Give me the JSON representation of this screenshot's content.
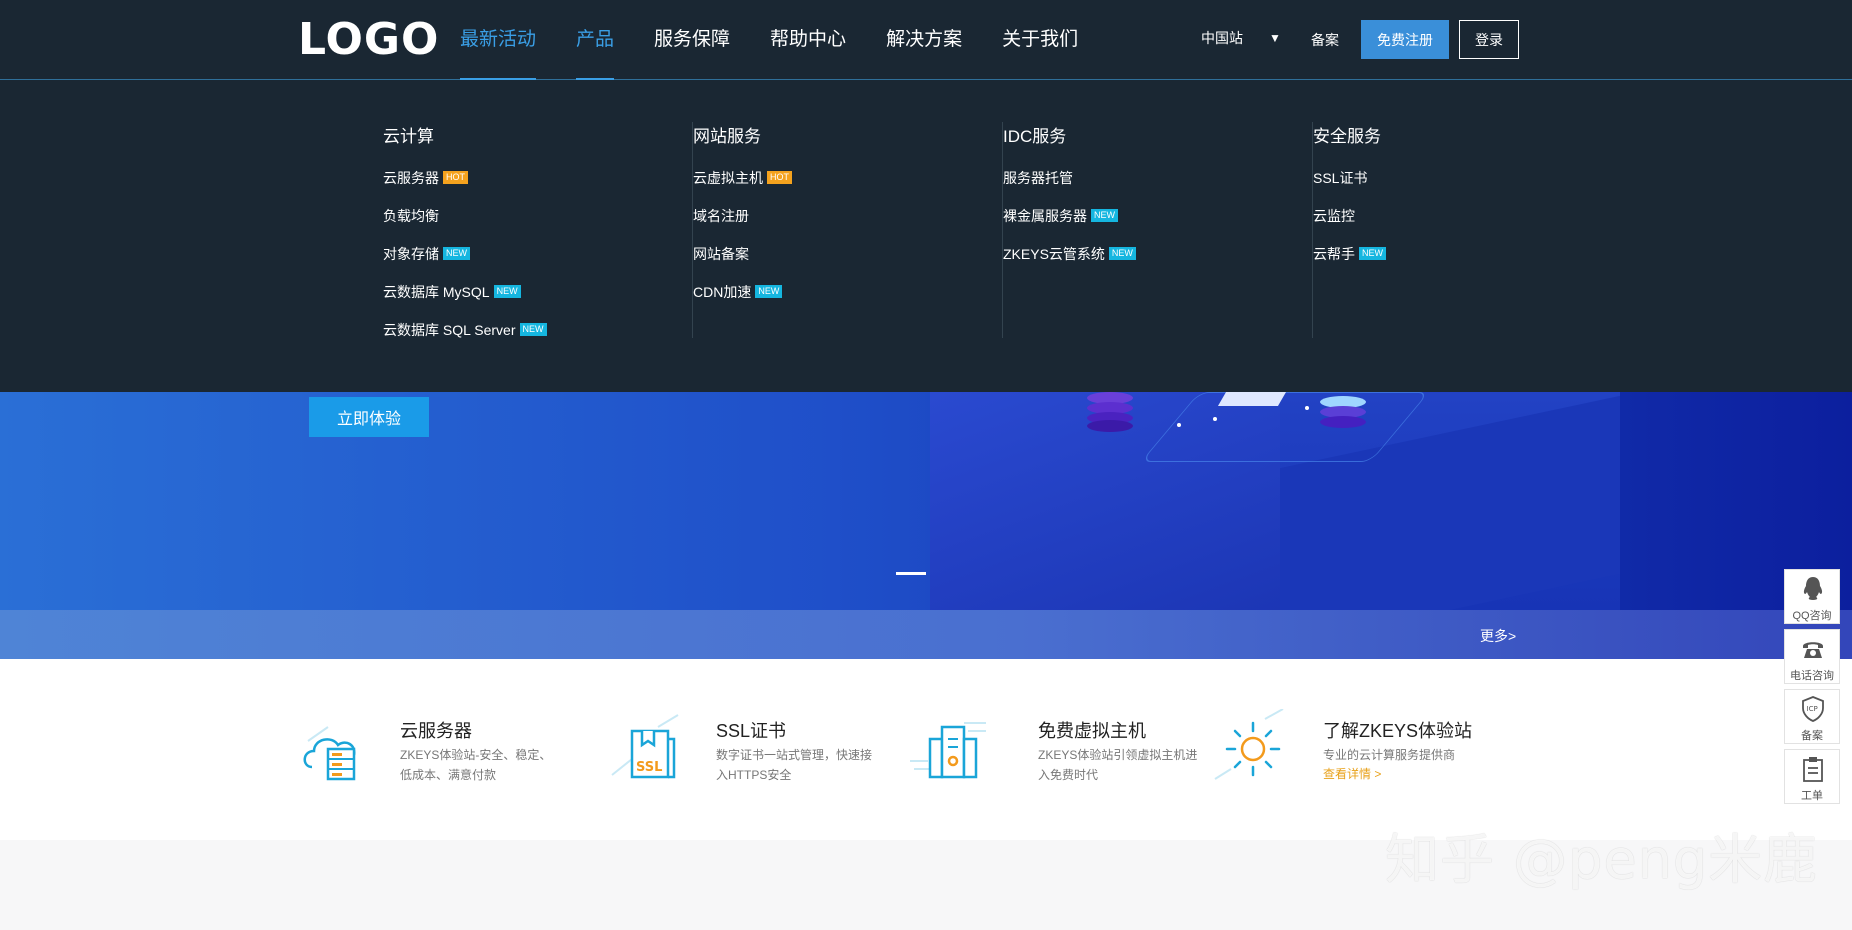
{
  "header": {
    "logo": "LOGO",
    "nav": [
      "最新活动",
      "产品",
      "服务保障",
      "帮助中心",
      "解决方案",
      "关于我们"
    ],
    "nav_active": [
      "最新活动",
      "产品"
    ],
    "site": "中国站",
    "site_arrow": "▼",
    "beian": "备案",
    "register": "免费注册",
    "login": "登录"
  },
  "dropdown": {
    "columns": [
      {
        "title": "云计算",
        "items": [
          {
            "label": "云服务器",
            "badge": "HOT"
          },
          {
            "label": "负载均衡",
            "badge": ""
          },
          {
            "label": "对象存储",
            "badge": "NEW"
          },
          {
            "label": "云数据库 MySQL",
            "badge": "NEW"
          },
          {
            "label": "云数据库 SQL Server",
            "badge": "NEW"
          }
        ]
      },
      {
        "title": "网站服务",
        "items": [
          {
            "label": "云虚拟主机",
            "badge": "HOT"
          },
          {
            "label": "域名注册",
            "badge": ""
          },
          {
            "label": "网站备案",
            "badge": ""
          },
          {
            "label": "CDN加速",
            "badge": "NEW"
          }
        ]
      },
      {
        "title": "IDC服务",
        "items": [
          {
            "label": "服务器托管",
            "badge": ""
          },
          {
            "label": "裸金属服务器",
            "badge": "NEW"
          },
          {
            "label": "ZKEYS云管系统",
            "badge": "NEW"
          }
        ]
      },
      {
        "title": "安全服务",
        "items": [
          {
            "label": "SSL证书",
            "badge": ""
          },
          {
            "label": "云监控",
            "badge": ""
          },
          {
            "label": "云帮手",
            "badge": "NEW"
          }
        ]
      }
    ]
  },
  "hero": {
    "cta": "立即体验"
  },
  "strip": {
    "more": "更多>"
  },
  "features": [
    {
      "icon": "cloud-server-icon",
      "title": "云服务器",
      "desc": "ZKEYS体验站-安全、稳定、低成本、满意付款",
      "link": ""
    },
    {
      "icon": "ssl-certificate-icon",
      "title": "SSL证书",
      "desc": "数字证书一站式管理，快速接入HTTPS安全",
      "link": ""
    },
    {
      "icon": "virtual-host-icon",
      "title": "免费虚拟主机",
      "desc": "ZKEYS体验站引领虚拟主机进入免费时代",
      "link": ""
    },
    {
      "icon": "sun-icon",
      "title": "了解ZKEYS体验站",
      "desc": "专业的云计算服务提供商",
      "link": "查看详情 >"
    }
  ],
  "sidebar": [
    {
      "icon": "qq-icon",
      "label": "QQ咨询"
    },
    {
      "icon": "phone-icon",
      "label": "电话咨询"
    },
    {
      "icon": "icp-icon",
      "label": "备案"
    },
    {
      "icon": "clipboard-icon",
      "label": "工单"
    }
  ],
  "watermark": "知乎 @peng米鹿",
  "colors": {
    "header_bg": "#1a2733",
    "accent": "#3a9fe6",
    "register_btn": "#3a8fd9",
    "hot_badge": "#f4a21e",
    "new_badge": "#15b6e0",
    "link_orange": "#e8a11a"
  }
}
